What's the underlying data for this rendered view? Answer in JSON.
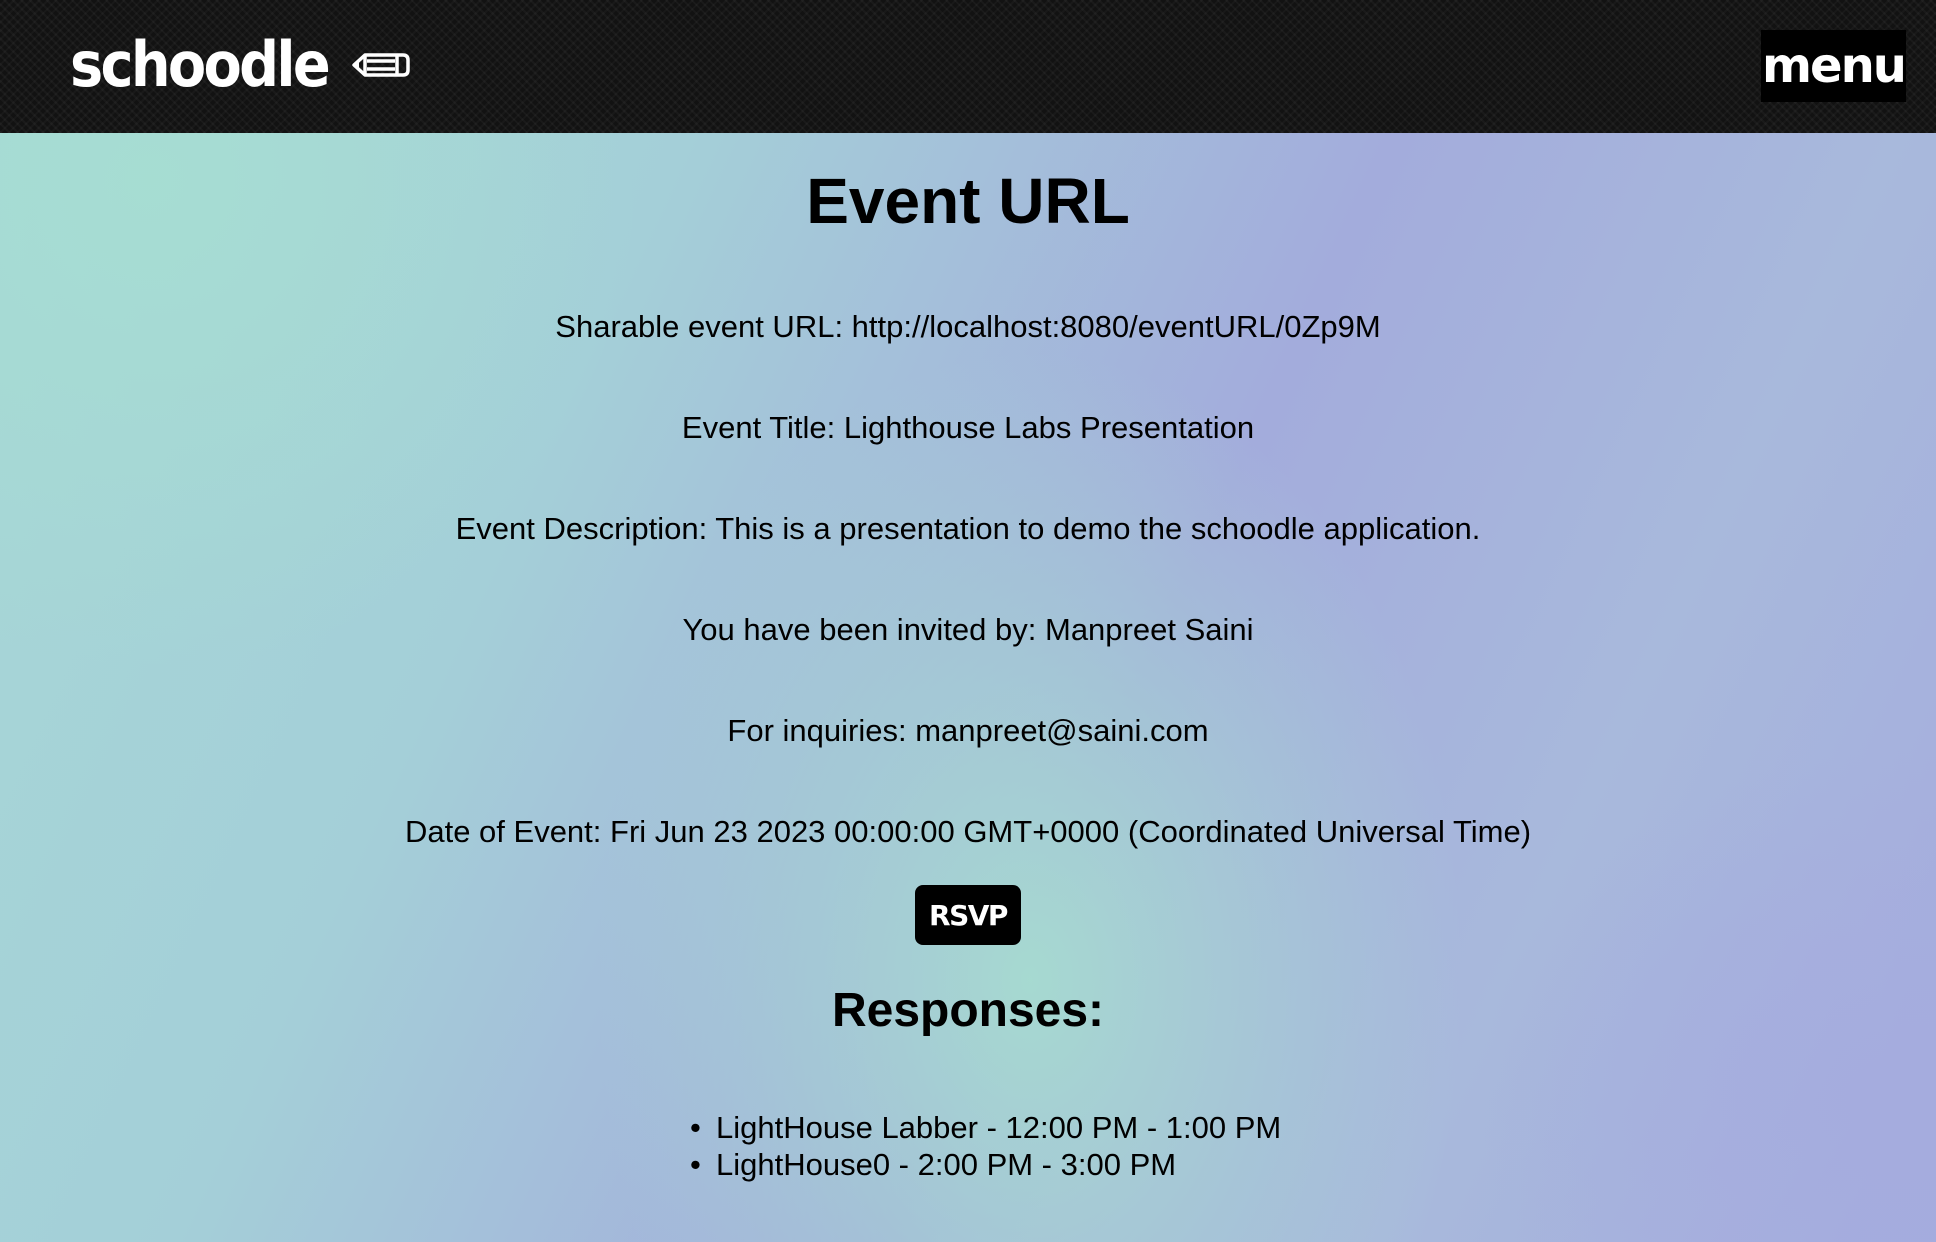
{
  "navbar": {
    "brand": "schoodle",
    "brand_icon": "pencil-icon",
    "menu_label": "menu"
  },
  "page": {
    "title": "Event URL",
    "share_url_line": "Sharable event URL: http://localhost:8080/eventURL/0Zp9M",
    "event_title_line": "Event Title: Lighthouse Labs Presentation",
    "event_description_line": "Event Description: This is a presentation to demo the schoodle application.",
    "invited_by_line": "You have been invited by: Manpreet Saini",
    "inquiries_line": "For inquiries: manpreet@saini.com",
    "date_line": "Date of Event: Fri Jun 23 2023 00:00:00 GMT+0000 (Coordinated Universal Time)",
    "rsvp_label": "RSVP"
  },
  "responses": {
    "title": "Responses:",
    "items": [
      "LightHouse Labber - 12:00 PM - 1:00 PM",
      "LightHouse0 - 2:00 PM - 3:00 PM"
    ]
  },
  "colors": {
    "navbar_bg": "#121212",
    "button_bg": "#000000",
    "gradient_teal": "#a7dcd2",
    "gradient_lavender": "#a3acdc"
  }
}
